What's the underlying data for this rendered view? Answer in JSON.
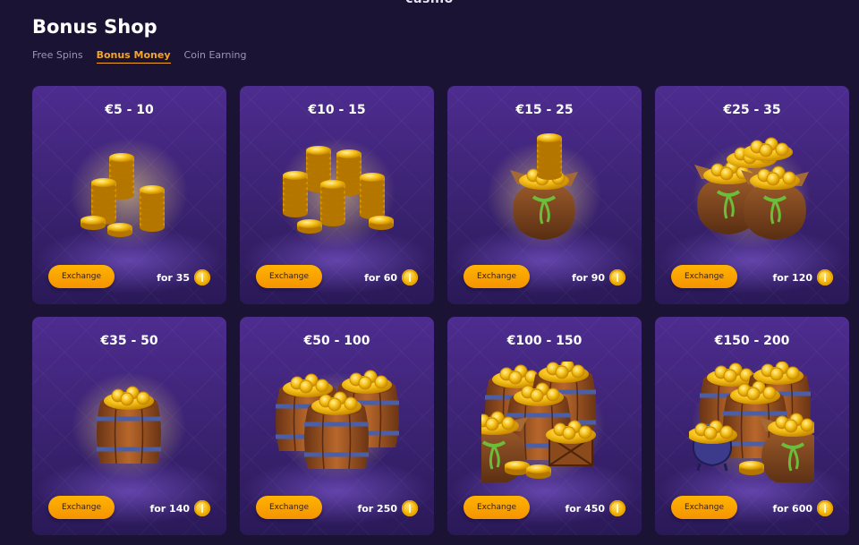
{
  "header": {
    "logo_text": "casino",
    "title": "Bonus Shop"
  },
  "tabs": [
    {
      "label": "Free Spins",
      "active": false
    },
    {
      "label": "Bonus Money",
      "active": true
    },
    {
      "label": "Coin Earning",
      "active": false
    }
  ],
  "colors": {
    "accent": "#f5a623",
    "background": "#1b1333",
    "card": "#3a2270"
  },
  "offers": [
    {
      "title": "€5 - 10",
      "button": "Exchange",
      "price": "for 35",
      "art": "coin-stacks-small"
    },
    {
      "title": "€10 - 15",
      "button": "Exchange",
      "price": "for 60",
      "art": "coin-stacks-large"
    },
    {
      "title": "€15 - 25",
      "button": "Exchange",
      "price": "for 90",
      "art": "coin-sack"
    },
    {
      "title": "€25 - 35",
      "button": "Exchange",
      "price": "for 120",
      "art": "coin-sacks-two"
    },
    {
      "title": "€35 - 50",
      "button": "Exchange",
      "price": "for 140",
      "art": "coin-barrel"
    },
    {
      "title": "€50 - 100",
      "button": "Exchange",
      "price": "for 250",
      "art": "coin-barrels-two"
    },
    {
      "title": "€100 - 150",
      "button": "Exchange",
      "price": "for 450",
      "art": "coin-barrels-crate"
    },
    {
      "title": "€150 - 200",
      "button": "Exchange",
      "price": "for 600",
      "art": "coin-treasure-pile"
    }
  ]
}
